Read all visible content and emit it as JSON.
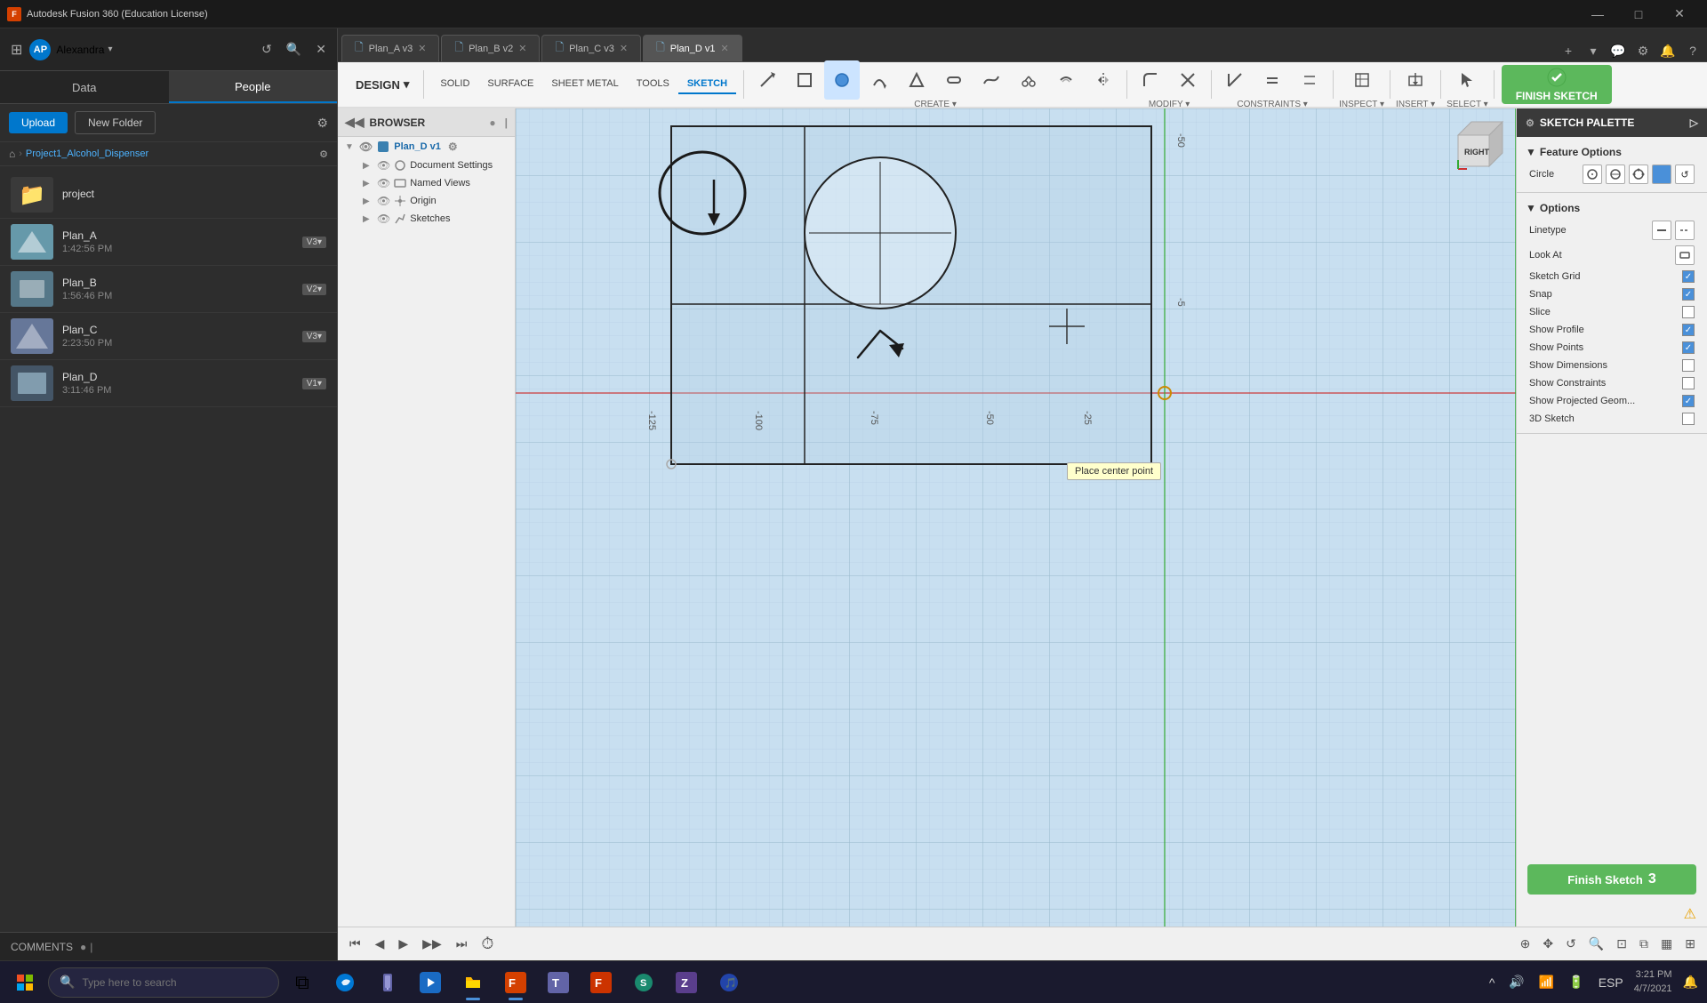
{
  "title_bar": {
    "app_name": "Autodesk Fusion 360 (Education License)",
    "icon_label": "F",
    "window_controls": {
      "minimize": "—",
      "maximize": "□",
      "close": "✕"
    }
  },
  "left_sidebar": {
    "user": {
      "name": "Alexandra",
      "initials": "AP",
      "chevron": "▾"
    },
    "tabs": {
      "data_label": "Data",
      "people_label": "People"
    },
    "actions": {
      "upload_label": "Upload",
      "new_folder_label": "New Folder"
    },
    "breadcrumb": {
      "home": "⌂",
      "separator": ">",
      "project_name": "Project1_Alcohol_Dispenser"
    },
    "files": [
      {
        "name": "project",
        "type": "folder",
        "date": ""
      },
      {
        "name": "Plan_A",
        "type": "design",
        "date": "1:42:56 PM",
        "version": "V3"
      },
      {
        "name": "Plan_B",
        "type": "design",
        "date": "1:56:46 PM",
        "version": "V2"
      },
      {
        "name": "Plan_C",
        "type": "design",
        "date": "2:23:50 PM",
        "version": "V3"
      },
      {
        "name": "Plan_D",
        "type": "design",
        "date": "3:11:46 PM",
        "version": "V1"
      }
    ]
  },
  "tabs": [
    {
      "label": "Plan_A v3",
      "id": "plan-a",
      "active": false
    },
    {
      "label": "Plan_B v2",
      "id": "plan-b",
      "active": false
    },
    {
      "label": "Plan_C v3",
      "id": "plan-c",
      "active": false
    },
    {
      "label": "Plan_D v1",
      "id": "plan-d",
      "active": true
    }
  ],
  "toolbar": {
    "design_label": "DESIGN",
    "design_chevron": "▾",
    "tabs": [
      "SOLID",
      "SURFACE",
      "SHEET METAL",
      "TOOLS",
      "SKETCH"
    ],
    "active_tab": "SKETCH",
    "sections": {
      "create_label": "CREATE",
      "modify_label": "MODIFY",
      "constraints_label": "CONSTRAINTS",
      "inspect_label": "INSPECT",
      "insert_label": "INSERT",
      "select_label": "SELECT",
      "finish_label": "FINISH SKETCH"
    }
  },
  "browser": {
    "title": "BROWSER",
    "items": [
      {
        "label": "Plan_D v1",
        "type": "component",
        "expanded": true
      },
      {
        "label": "Document Settings",
        "type": "settings",
        "expanded": false,
        "indent": 1
      },
      {
        "label": "Named Views",
        "type": "view",
        "expanded": false,
        "indent": 1
      },
      {
        "label": "Origin",
        "type": "origin",
        "expanded": false,
        "indent": 1
      },
      {
        "label": "Sketches",
        "type": "sketch",
        "expanded": false,
        "indent": 1
      }
    ]
  },
  "sketch_palette": {
    "title": "SKETCH PALETTE",
    "sections": {
      "feature_options": {
        "label": "Feature Options",
        "circle_label": "Circle",
        "linetype_label": "Linetype",
        "look_at_label": "Look At",
        "sketch_grid_label": "Sketch Grid",
        "snap_label": "Snap",
        "slice_label": "Slice",
        "show_profile_label": "Show Profile",
        "show_points_label": "Show Points",
        "show_dimensions_label": "Show Dimensions",
        "show_constraints_label": "Show Constraints",
        "show_projected_geom_label": "Show Projected Geom...",
        "checkboxes": {
          "sketch_grid": true,
          "snap": true,
          "slice": false,
          "show_profile": true,
          "show_points": true,
          "show_dimensions": false,
          "show_constraints": false,
          "show_projected_geom": true
        }
      }
    },
    "finish_sketch_label": "Finish Sketch"
  },
  "canvas": {
    "tooltip": "Place center point",
    "view_label": "RIGHT"
  },
  "comments_bar": {
    "label": "COMMENTS"
  },
  "bottom_bar": {
    "buttons": [
      "⏮",
      "◀",
      "▶",
      "▶▶",
      "⏭"
    ]
  },
  "taskbar": {
    "search_placeholder": "Type here to search",
    "time": "3:21 PM",
    "date": "4/7/2021",
    "language": "ESP",
    "apps": [
      {
        "icon": "⊞",
        "label": "start"
      },
      {
        "icon": "🔍",
        "label": "search"
      },
      {
        "icon": "⧉",
        "label": "task-view"
      },
      {
        "icon": "🌐",
        "label": "edge"
      },
      {
        "icon": "📱",
        "label": "phone"
      },
      {
        "icon": "▶",
        "label": "media"
      },
      {
        "icon": "📁",
        "label": "files"
      },
      {
        "icon": "F",
        "label": "fusion"
      },
      {
        "icon": "W",
        "label": "word"
      }
    ]
  }
}
